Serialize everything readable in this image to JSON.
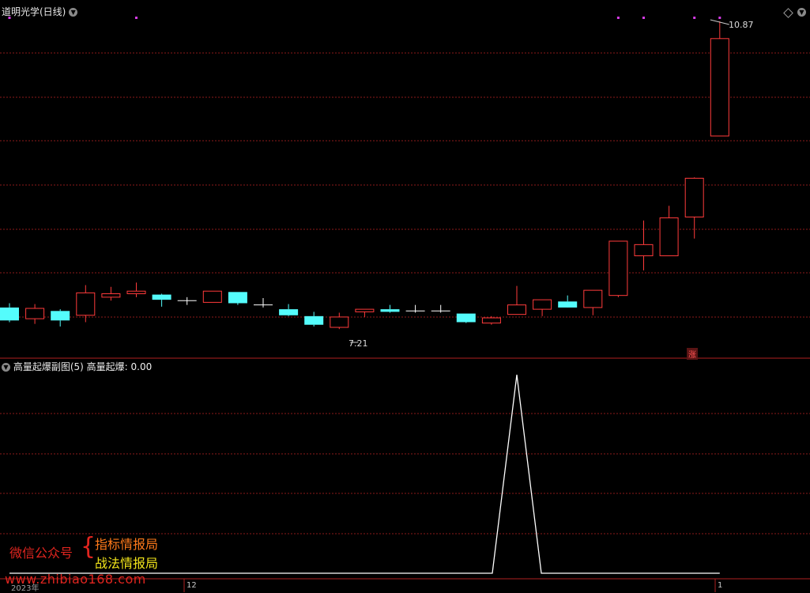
{
  "main_panel": {
    "title": "道明光学(日线)",
    "high_label": "10.87",
    "low_label": "7.21",
    "signal_badge": "涨"
  },
  "sub_panel": {
    "title": "高量起爆副图(5)",
    "indicator_label": "高量起爆: 0.00"
  },
  "watermark": {
    "left": "微信公众号",
    "right_top": "指标情报局",
    "right_bottom": "战法情报局",
    "url": "www.zhibiao168.com"
  },
  "axis": {
    "year_label": "2023年",
    "month_dec": "12",
    "month_jan": "1"
  },
  "colors": {
    "up": "#ff3b3b",
    "down": "#54fcfc",
    "grid": "#8b1a1a",
    "signal_dot": "#d63be6",
    "indicator_line": "#ffffff"
  },
  "chart_data": [
    {
      "type": "candlestick",
      "title": "道明光学(日线)",
      "max_label": 10.87,
      "min_label": 7.21,
      "ohlc": [
        {
          "o": 7.55,
          "h": 7.6,
          "l": 7.38,
          "c": 7.4
        },
        {
          "o": 7.42,
          "h": 7.59,
          "l": 7.36,
          "c": 7.54
        },
        {
          "o": 7.51,
          "h": 7.53,
          "l": 7.33,
          "c": 7.4
        },
        {
          "o": 7.46,
          "h": 7.81,
          "l": 7.38,
          "c": 7.72
        },
        {
          "o": 7.67,
          "h": 7.79,
          "l": 7.63,
          "c": 7.71
        },
        {
          "o": 7.71,
          "h": 7.84,
          "l": 7.67,
          "c": 7.74
        },
        {
          "o": 7.7,
          "h": 7.71,
          "l": 7.56,
          "c": 7.64
        },
        {
          "o": 7.63,
          "h": 7.67,
          "l": 7.58,
          "c": 7.63
        },
        {
          "o": 7.61,
          "h": 7.74,
          "l": 7.61,
          "c": 7.74
        },
        {
          "o": 7.73,
          "h": 7.73,
          "l": 7.58,
          "c": 7.6
        },
        {
          "o": 7.58,
          "h": 7.66,
          "l": 7.55,
          "c": 7.58
        },
        {
          "o": 7.53,
          "h": 7.59,
          "l": 7.45,
          "c": 7.46
        },
        {
          "o": 7.45,
          "h": 7.5,
          "l": 7.33,
          "c": 7.35
        },
        {
          "o": 7.32,
          "h": 7.49,
          "l": 7.3,
          "c": 7.44
        },
        {
          "o": 7.5,
          "h": 7.52,
          "l": 7.44,
          "c": 7.53
        },
        {
          "o": 7.53,
          "h": 7.58,
          "l": 7.49,
          "c": 7.5
        },
        {
          "o": 7.51,
          "h": 7.58,
          "l": 7.49,
          "c": 7.51
        },
        {
          "o": 7.51,
          "h": 7.58,
          "l": 7.49,
          "c": 7.51
        },
        {
          "o": 7.48,
          "h": 7.48,
          "l": 7.37,
          "c": 7.38
        },
        {
          "o": 7.37,
          "h": 7.45,
          "l": 7.35,
          "c": 7.43
        },
        {
          "o": 7.47,
          "h": 7.8,
          "l": 7.47,
          "c": 7.58
        },
        {
          "o": 7.53,
          "h": 7.64,
          "l": 7.45,
          "c": 7.64
        },
        {
          "o": 7.62,
          "h": 7.69,
          "l": 7.57,
          "c": 7.55
        },
        {
          "o": 7.55,
          "h": 7.74,
          "l": 7.46,
          "c": 7.75
        },
        {
          "o": 7.69,
          "h": 8.32,
          "l": 7.67,
          "c": 8.32
        },
        {
          "o": 8.15,
          "h": 8.56,
          "l": 7.98,
          "c": 8.28
        },
        {
          "o": 8.15,
          "h": 8.73,
          "l": 8.15,
          "c": 8.59
        },
        {
          "o": 8.6,
          "h": 9.06,
          "l": 8.35,
          "c": 9.05
        },
        {
          "o": 9.54,
          "h": 10.87,
          "l": 9.54,
          "c": 10.67
        }
      ],
      "signal_dots_at": [
        0,
        5,
        24,
        25,
        27,
        28
      ]
    },
    {
      "type": "line",
      "title": "高量起爆副图(5)",
      "series": [
        {
          "name": "高量起爆",
          "values": [
            0,
            0,
            0,
            0,
            0,
            0,
            0,
            0,
            0,
            0,
            0,
            0,
            0,
            0,
            0,
            0,
            0,
            0,
            0,
            0,
            1,
            0,
            0,
            0,
            0,
            0,
            0,
            0,
            0
          ]
        }
      ]
    }
  ]
}
